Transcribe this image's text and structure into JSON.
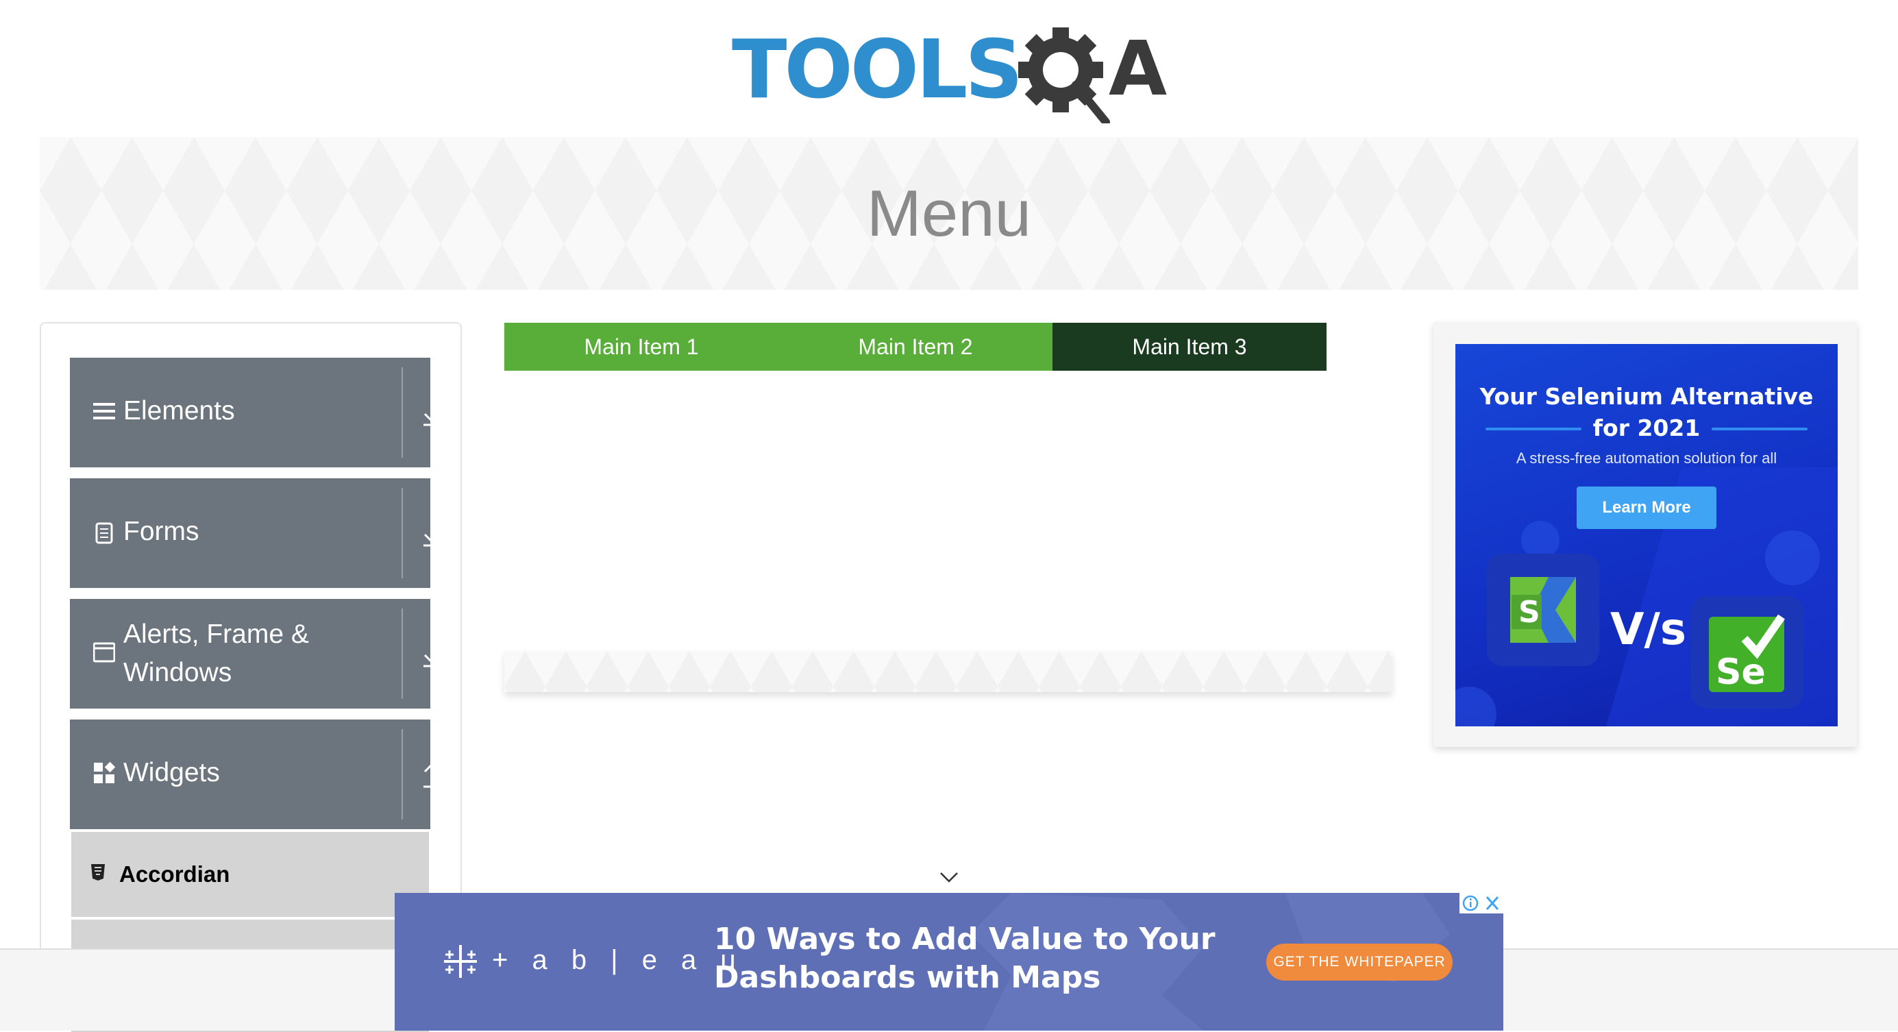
{
  "header": {
    "logo_text": "TOOLS",
    "logo_suffix": "A"
  },
  "banner": {
    "title": "Menu"
  },
  "sidebar": {
    "groups": [
      {
        "title": "Elements",
        "icon": "hamburger-icon",
        "state": "collapsed",
        "arrow": "download-icon"
      },
      {
        "title": "Forms",
        "icon": "document-icon",
        "state": "collapsed",
        "arrow": "download-icon"
      },
      {
        "title": "Alerts, Frame & Windows",
        "title_line1": "Alerts, Frame &",
        "title_line2": "Windows",
        "icon": "window-icon",
        "state": "collapsed",
        "arrow": "download-icon"
      },
      {
        "title": "Widgets",
        "icon": "widgets-icon",
        "state": "expanded",
        "arrow": "upload-icon"
      }
    ],
    "active_item": {
      "label": "Accordian",
      "icon": "html5-icon"
    }
  },
  "nav": {
    "items": [
      {
        "label": "Main Item 1"
      },
      {
        "label": "Main Item 2"
      },
      {
        "label": "Main Item 3"
      }
    ]
  },
  "right_ad": {
    "headline_line1": "Your Selenium Alternative",
    "headline_line2": "for 2021",
    "subtext": "A stress-free automation solution for all",
    "cta": "Learn More",
    "vs_text": "V/s",
    "logo_left": "S",
    "logo_right": "Se"
  },
  "bottom_ad": {
    "brand": "+ a b | e a u",
    "headline_line1": "10 Ways to Add Value to Your",
    "headline_line2": "Dashboards with Maps",
    "cta": "GET THE WHITEPAPER"
  },
  "colors": {
    "nav_green": "#59ae3a",
    "nav_dark": "#1b3b20",
    "sidebar_header": "#6c757d",
    "sidebar_active": "#d4d4d4",
    "logo_blue": "#2f8fce",
    "ad_blue": "#1747d8",
    "ad_orange": "#f08a3c"
  }
}
